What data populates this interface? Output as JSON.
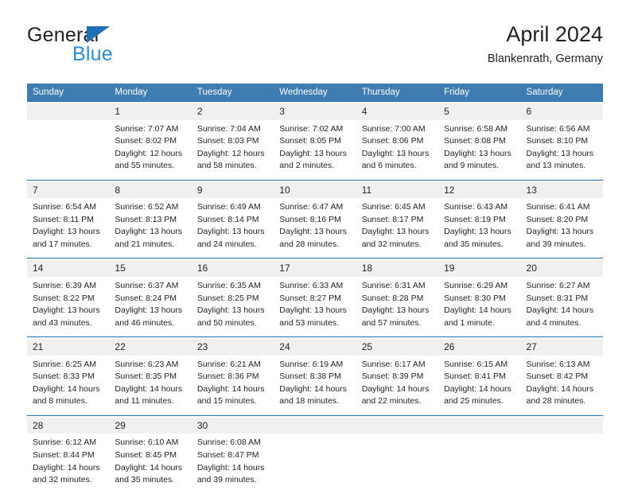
{
  "brand": {
    "name_top": "General",
    "name_bottom": "Blue",
    "accent_dark_blue": "#1f6fb5",
    "accent_light_blue": "#2b8ddb"
  },
  "header": {
    "title": "April 2024",
    "subtitle": "Blankenrath, Germany"
  },
  "theme": {
    "header_bg": "#3e7cb1",
    "header_text": "#ffffff",
    "daynum_bg": "#f0f0f0",
    "separator": "#1f6fb5",
    "text": "#231f20"
  },
  "calendar": {
    "weekday_headers": [
      "Sunday",
      "Monday",
      "Tuesday",
      "Wednesday",
      "Thursday",
      "Friday",
      "Saturday"
    ],
    "weeks": [
      [
        {
          "day": "",
          "lines": []
        },
        {
          "day": "1",
          "lines": [
            "Sunrise: 7:07 AM",
            "Sunset: 8:02 PM",
            "Daylight: 12 hours",
            "and 55 minutes."
          ]
        },
        {
          "day": "2",
          "lines": [
            "Sunrise: 7:04 AM",
            "Sunset: 8:03 PM",
            "Daylight: 12 hours",
            "and 58 minutes."
          ]
        },
        {
          "day": "3",
          "lines": [
            "Sunrise: 7:02 AM",
            "Sunset: 8:05 PM",
            "Daylight: 13 hours",
            "and 2 minutes."
          ]
        },
        {
          "day": "4",
          "lines": [
            "Sunrise: 7:00 AM",
            "Sunset: 8:06 PM",
            "Daylight: 13 hours",
            "and 6 minutes."
          ]
        },
        {
          "day": "5",
          "lines": [
            "Sunrise: 6:58 AM",
            "Sunset: 8:08 PM",
            "Daylight: 13 hours",
            "and 9 minutes."
          ]
        },
        {
          "day": "6",
          "lines": [
            "Sunrise: 6:56 AM",
            "Sunset: 8:10 PM",
            "Daylight: 13 hours",
            "and 13 minutes."
          ]
        }
      ],
      [
        {
          "day": "7",
          "lines": [
            "Sunrise: 6:54 AM",
            "Sunset: 8:11 PM",
            "Daylight: 13 hours",
            "and 17 minutes."
          ]
        },
        {
          "day": "8",
          "lines": [
            "Sunrise: 6:52 AM",
            "Sunset: 8:13 PM",
            "Daylight: 13 hours",
            "and 21 minutes."
          ]
        },
        {
          "day": "9",
          "lines": [
            "Sunrise: 6:49 AM",
            "Sunset: 8:14 PM",
            "Daylight: 13 hours",
            "and 24 minutes."
          ]
        },
        {
          "day": "10",
          "lines": [
            "Sunrise: 6:47 AM",
            "Sunset: 8:16 PM",
            "Daylight: 13 hours",
            "and 28 minutes."
          ]
        },
        {
          "day": "11",
          "lines": [
            "Sunrise: 6:45 AM",
            "Sunset: 8:17 PM",
            "Daylight: 13 hours",
            "and 32 minutes."
          ]
        },
        {
          "day": "12",
          "lines": [
            "Sunrise: 6:43 AM",
            "Sunset: 8:19 PM",
            "Daylight: 13 hours",
            "and 35 minutes."
          ]
        },
        {
          "day": "13",
          "lines": [
            "Sunrise: 6:41 AM",
            "Sunset: 8:20 PM",
            "Daylight: 13 hours",
            "and 39 minutes."
          ]
        }
      ],
      [
        {
          "day": "14",
          "lines": [
            "Sunrise: 6:39 AM",
            "Sunset: 8:22 PM",
            "Daylight: 13 hours",
            "and 43 minutes."
          ]
        },
        {
          "day": "15",
          "lines": [
            "Sunrise: 6:37 AM",
            "Sunset: 8:24 PM",
            "Daylight: 13 hours",
            "and 46 minutes."
          ]
        },
        {
          "day": "16",
          "lines": [
            "Sunrise: 6:35 AM",
            "Sunset: 8:25 PM",
            "Daylight: 13 hours",
            "and 50 minutes."
          ]
        },
        {
          "day": "17",
          "lines": [
            "Sunrise: 6:33 AM",
            "Sunset: 8:27 PM",
            "Daylight: 13 hours",
            "and 53 minutes."
          ]
        },
        {
          "day": "18",
          "lines": [
            "Sunrise: 6:31 AM",
            "Sunset: 8:28 PM",
            "Daylight: 13 hours",
            "and 57 minutes."
          ]
        },
        {
          "day": "19",
          "lines": [
            "Sunrise: 6:29 AM",
            "Sunset: 8:30 PM",
            "Daylight: 14 hours",
            "and 1 minute."
          ]
        },
        {
          "day": "20",
          "lines": [
            "Sunrise: 6:27 AM",
            "Sunset: 8:31 PM",
            "Daylight: 14 hours",
            "and 4 minutes."
          ]
        }
      ],
      [
        {
          "day": "21",
          "lines": [
            "Sunrise: 6:25 AM",
            "Sunset: 8:33 PM",
            "Daylight: 14 hours",
            "and 8 minutes."
          ]
        },
        {
          "day": "22",
          "lines": [
            "Sunrise: 6:23 AM",
            "Sunset: 8:35 PM",
            "Daylight: 14 hours",
            "and 11 minutes."
          ]
        },
        {
          "day": "23",
          "lines": [
            "Sunrise: 6:21 AM",
            "Sunset: 8:36 PM",
            "Daylight: 14 hours",
            "and 15 minutes."
          ]
        },
        {
          "day": "24",
          "lines": [
            "Sunrise: 6:19 AM",
            "Sunset: 8:38 PM",
            "Daylight: 14 hours",
            "and 18 minutes."
          ]
        },
        {
          "day": "25",
          "lines": [
            "Sunrise: 6:17 AM",
            "Sunset: 8:39 PM",
            "Daylight: 14 hours",
            "and 22 minutes."
          ]
        },
        {
          "day": "26",
          "lines": [
            "Sunrise: 6:15 AM",
            "Sunset: 8:41 PM",
            "Daylight: 14 hours",
            "and 25 minutes."
          ]
        },
        {
          "day": "27",
          "lines": [
            "Sunrise: 6:13 AM",
            "Sunset: 8:42 PM",
            "Daylight: 14 hours",
            "and 28 minutes."
          ]
        }
      ],
      [
        {
          "day": "28",
          "lines": [
            "Sunrise: 6:12 AM",
            "Sunset: 8:44 PM",
            "Daylight: 14 hours",
            "and 32 minutes."
          ]
        },
        {
          "day": "29",
          "lines": [
            "Sunrise: 6:10 AM",
            "Sunset: 8:45 PM",
            "Daylight: 14 hours",
            "and 35 minutes."
          ]
        },
        {
          "day": "30",
          "lines": [
            "Sunrise: 6:08 AM",
            "Sunset: 8:47 PM",
            "Daylight: 14 hours",
            "and 39 minutes."
          ]
        },
        {
          "day": "",
          "lines": []
        },
        {
          "day": "",
          "lines": []
        },
        {
          "day": "",
          "lines": []
        },
        {
          "day": "",
          "lines": []
        }
      ]
    ]
  }
}
